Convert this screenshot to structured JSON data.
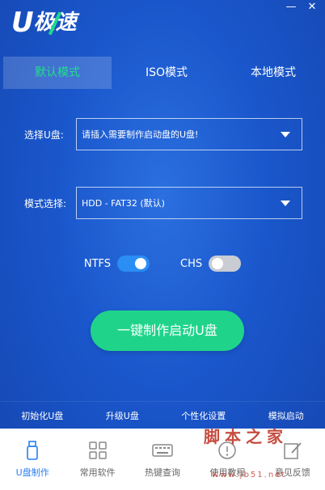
{
  "window": {
    "minimize": "—",
    "close": "✕"
  },
  "logo": {
    "u": "U",
    "text": "极速"
  },
  "tabs": [
    {
      "label": "默认模式"
    },
    {
      "label": "ISO模式"
    },
    {
      "label": "本地模式"
    }
  ],
  "usb_select": {
    "label": "选择U盘:",
    "value": "请插入需要制作启动盘的U盘!"
  },
  "mode_select": {
    "label": "模式选择:",
    "value": "HDD - FAT32 (默认)"
  },
  "toggles": {
    "ntfs": {
      "label": "NTFS",
      "state": "on"
    },
    "chs": {
      "label": "CHS",
      "state": "off"
    }
  },
  "make_button": "一键制作启动U盘",
  "links": [
    "初始化U盘",
    "升级U盘",
    "个性化设置",
    "模拟启动"
  ],
  "nav": [
    {
      "label": "U盘制作",
      "icon": "usb-drive-icon"
    },
    {
      "label": "常用软件",
      "icon": "apps-grid-icon"
    },
    {
      "label": "热键查询",
      "icon": "keyboard-icon"
    },
    {
      "label": "使用教程",
      "icon": "book-icon"
    },
    {
      "label": "意见反馈",
      "icon": "edit-icon"
    }
  ],
  "watermark": {
    "main": "脚本之家",
    "sub": "www.jb51.net"
  },
  "colors": {
    "accent": "#1fd48a",
    "background": "#1a56c8",
    "switch_on": "#2a8ef5",
    "nav_active": "#2a7ff0"
  }
}
